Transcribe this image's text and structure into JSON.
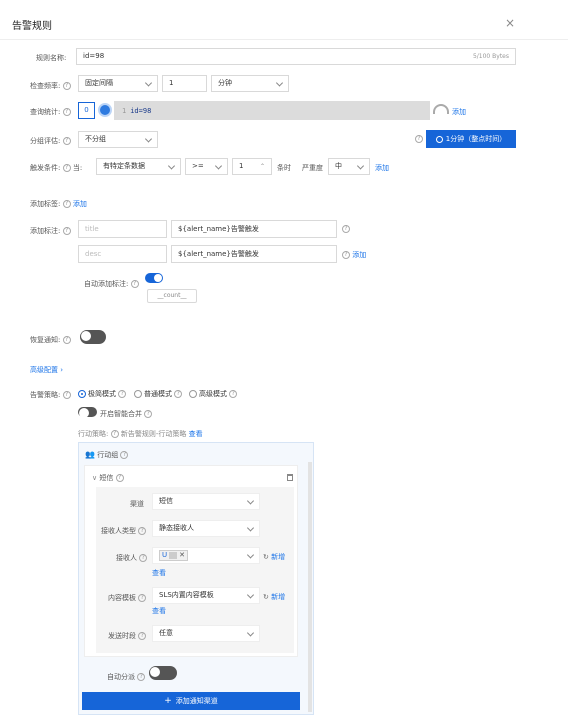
{
  "dialog": {
    "title": "告警规则"
  },
  "rule_name": {
    "label": "规则名称:",
    "value": "id=98",
    "counter": "5/100 Bytes"
  },
  "check_freq": {
    "label": "检查频率:",
    "mode": "固定间隔",
    "value": "1",
    "unit": "分钟"
  },
  "query": {
    "label": "查询统计:",
    "count": "0",
    "line_no": "1",
    "text": "id=98",
    "add": "添加"
  },
  "group_eval": {
    "label": "分组评估:",
    "value": "不分组",
    "time_button": "1分钟（整点时间）"
  },
  "trigger": {
    "label": "触发条件:",
    "when": "当:",
    "data": "有特定条数据",
    "op": ">=",
    "count": "1",
    "then": "条时",
    "severity_label": "严重度",
    "severity": "中",
    "add": "添加"
  },
  "labels": {
    "label": "添加标签:",
    "add": "添加"
  },
  "annotations": {
    "label": "添加标注:",
    "rows": [
      {
        "key_placeholder": "title",
        "value": "${alert_name}告警触发"
      },
      {
        "key_placeholder": "desc",
        "value": "${alert_name}告警触发",
        "add": "添加"
      }
    ],
    "auto_label": "自动添加标注:",
    "auto_tag": "__count__"
  },
  "recovery": {
    "label": "恢复通知:"
  },
  "advanced": {
    "label": "高级配置"
  },
  "policy": {
    "label": "告警策略:",
    "modes": [
      "极简模式",
      "普通模式",
      "高级模式"
    ],
    "smart_merge": "开启智能合并",
    "action_policy_label": "行动策略:",
    "action_policy_value": "新告警规则-行动策略",
    "view": "查看"
  },
  "action_group": {
    "title": "行动组",
    "channel_section": "短信",
    "fields": {
      "channel": {
        "label": "渠道",
        "value": "短信"
      },
      "recipient_type": {
        "label": "接收人类型",
        "value": "静态接收人"
      },
      "recipient": {
        "label": "接收人",
        "tag": "U",
        "new": "新增",
        "view": "查看"
      },
      "template": {
        "label": "内容模板",
        "value": "SLS内置内容模板",
        "new": "新增",
        "view": "查看"
      },
      "send_period": {
        "label": "发送时段",
        "value": "任意"
      }
    },
    "auto_split": "自动分派",
    "add_channel": "添加通知渠道"
  }
}
